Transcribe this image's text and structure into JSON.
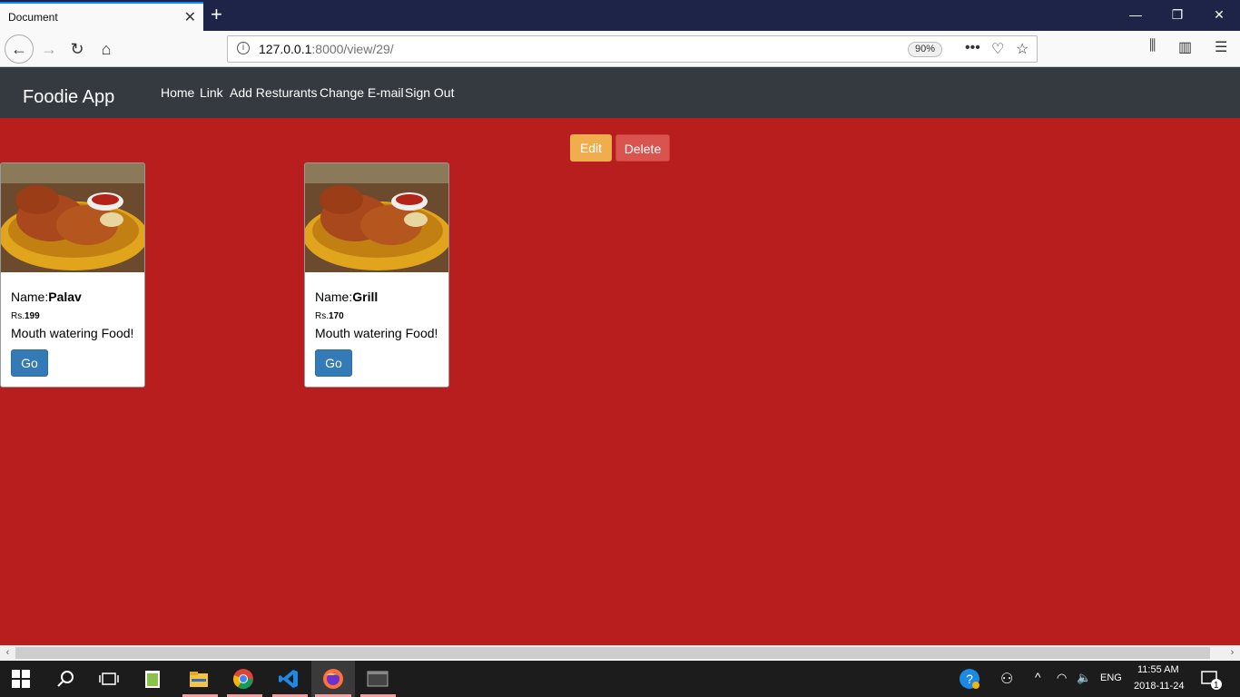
{
  "browser": {
    "tab_title": "Document",
    "url_host": "127.0.0.1",
    "url_rest": ":8000/view/29/",
    "zoom": "90%"
  },
  "app": {
    "brand": "Foodie App",
    "nav": [
      "Home",
      "Link",
      "Add Resturants",
      "Change E-mail",
      "Sign Out"
    ]
  },
  "actions": {
    "edit": "Edit",
    "delete": "Delete"
  },
  "cards": [
    {
      "name_label": "Name:",
      "name": "Palav",
      "price_label": "Rs.",
      "price": "199",
      "desc": "Mouth watering Food!",
      "button": "Go"
    },
    {
      "name_label": "Name:",
      "name": "Grill",
      "price_label": "Rs.",
      "price": "170",
      "desc": "Mouth watering Food!",
      "button": "Go"
    }
  ],
  "taskbar": {
    "time": "11:55 AM",
    "date": "2018-11-24",
    "lang": "ENG",
    "notification_count": "1"
  }
}
